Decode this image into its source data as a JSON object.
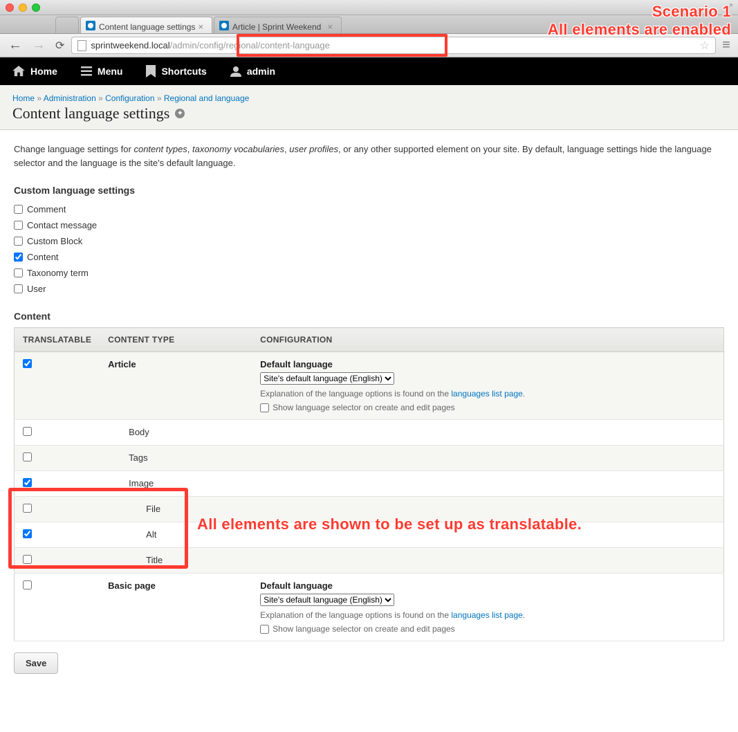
{
  "browser": {
    "tabs": [
      {
        "title": "Content language settings"
      },
      {
        "title": "Article | Sprint Weekend"
      }
    ],
    "url_domain": "sprintweekend.local",
    "url_path": "/admin/config/regional/content-language"
  },
  "annotation_top_line1": "Scenario 1",
  "annotation_top_line2": "All elements are enabled",
  "annotation_mid": "All elements are shown to be set up as translatable.",
  "admin": {
    "home": "Home",
    "menu": "Menu",
    "shortcuts": "Shortcuts",
    "user": "admin"
  },
  "breadcrumbs": {
    "home": "Home",
    "admin": "Administration",
    "config": "Configuration",
    "regional": "Regional and language"
  },
  "page_title": "Content language settings",
  "intro_prefix": "Change language settings for ",
  "intro_em1": "content types",
  "intro_sep": ", ",
  "intro_em2": "taxonomy vocabularies",
  "intro_em3": "user profiles",
  "intro_suffix": ", or any other supported element on your site. By default, language settings hide the language selector and the language is the site's default language.",
  "custom_heading": "Custom language settings",
  "custom_items": [
    {
      "label": "Comment",
      "checked": false
    },
    {
      "label": "Contact message",
      "checked": false
    },
    {
      "label": "Custom Block",
      "checked": false
    },
    {
      "label": "Content",
      "checked": true
    },
    {
      "label": "Taxonomy term",
      "checked": false
    },
    {
      "label": "User",
      "checked": false
    }
  ],
  "content_heading": "Content",
  "table": {
    "head_translatable": "TRANSLATABLE",
    "head_type": "CONTENT TYPE",
    "head_config": "CONFIGURATION",
    "default_lang_label": "Default language",
    "default_lang_option": "Site's default language (English)",
    "explain_prefix": "Explanation of the language options is found on the ",
    "explain_link": "languages list page",
    "explain_suffix": ".",
    "show_selector": "Show language selector on create and edit pages",
    "rows": [
      {
        "label": "Article",
        "level": 0,
        "checked": true,
        "has_config": true
      },
      {
        "label": "Body",
        "level": 1,
        "checked": false
      },
      {
        "label": "Tags",
        "level": 1,
        "checked": false
      },
      {
        "label": "Image",
        "level": 1,
        "checked": true
      },
      {
        "label": "File",
        "level": 2,
        "checked": false
      },
      {
        "label": "Alt",
        "level": 2,
        "checked": true
      },
      {
        "label": "Title",
        "level": 2,
        "checked": false
      },
      {
        "label": "Basic page",
        "level": 0,
        "checked": false,
        "has_config": true
      }
    ]
  },
  "save_label": "Save"
}
